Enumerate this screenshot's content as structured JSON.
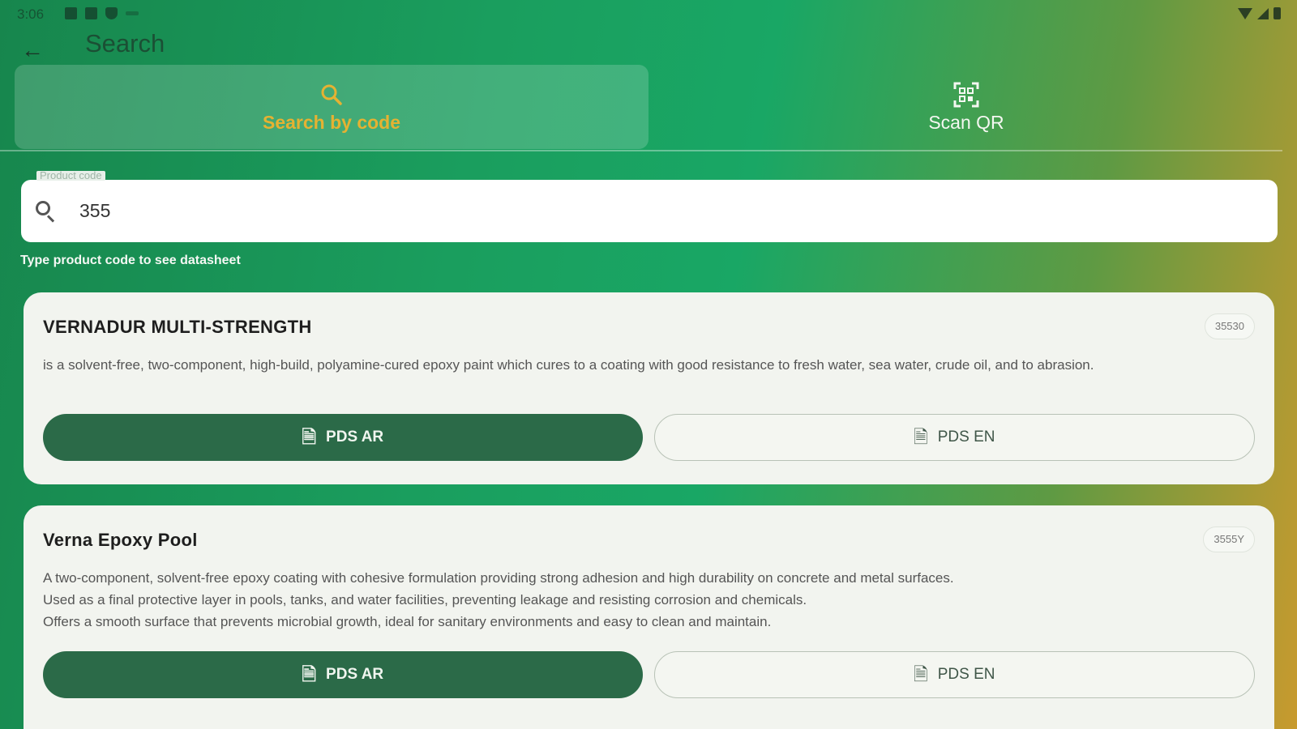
{
  "status_bar": {
    "time": "3:06"
  },
  "app_bar": {
    "title": "Search"
  },
  "tabs": [
    {
      "label": "Search by code",
      "icon": "search-icon",
      "active": true
    },
    {
      "label": "Scan QR",
      "icon": "qr-scan-icon",
      "active": false
    }
  ],
  "search": {
    "label": "Product code",
    "value": "355",
    "helper": "Type product code to see datasheet"
  },
  "results": [
    {
      "title": "VERNADUR MULTI-STRENGTH",
      "code": "35530",
      "description": "is a solvent-free, two-component, high-build, polyamine-cured epoxy paint which cures to a coating with good resistance to fresh water, sea water, crude oil, and to abrasion.",
      "btn_ar": "PDS AR",
      "btn_en": "PDS EN"
    },
    {
      "title": "Verna Epoxy Pool",
      "code": "3555Y",
      "description_lines": [
        "A two-component, solvent-free epoxy coating with cohesive formulation providing strong adhesion and high durability on concrete and metal surfaces.",
        "Used as a final protective layer in pools, tanks, and water facilities, preventing leakage and resisting corrosion and chemicals.",
        "Offers a smooth surface that prevents microbial growth, ideal for sanitary environments and easy to clean and maintain."
      ],
      "btn_ar": "PDS AR",
      "btn_en": "PDS EN"
    }
  ],
  "colors": {
    "accent_gold": "#e5b232",
    "button_green": "#2b6a48",
    "card_bg": "#f2f4ef"
  }
}
